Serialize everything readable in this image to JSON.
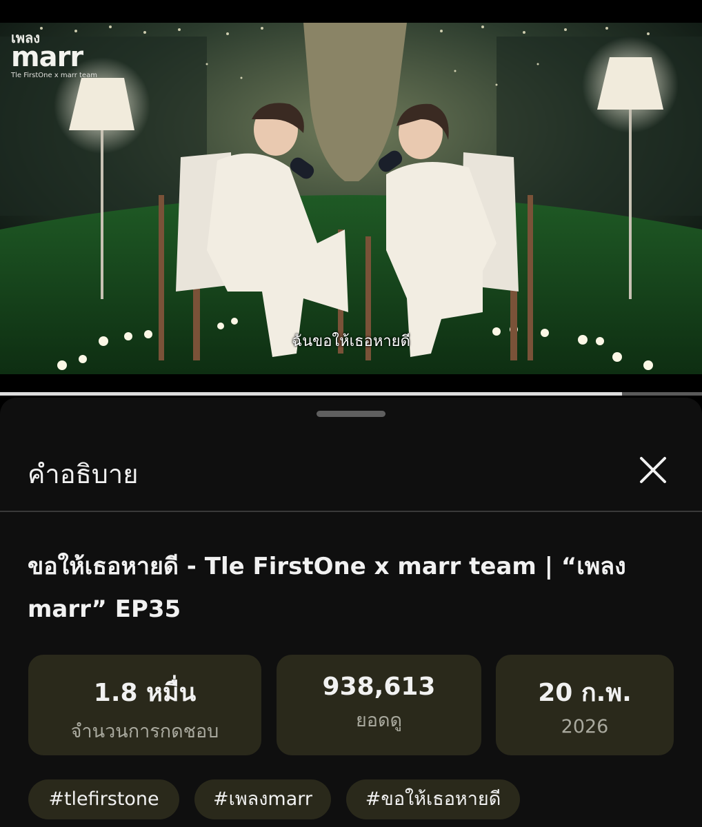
{
  "video": {
    "logo_line1": "เพลง",
    "logo_line2": "marr",
    "logo_line3": "Tle FirstOne x marr team",
    "subtitle": "ฉันขอให้เธอหายดี",
    "progress": 0.886
  },
  "sheet": {
    "title": "คำอธิบาย",
    "close_icon": "close-icon",
    "video_title": "ขอให้เธอหายดี - Tle FirstOne x marr team  |  “เพลง marr” EP35",
    "stats": {
      "likes_value": "1.8 หมื่น",
      "likes_label": "จำนวนการกดชอบ",
      "views_value": "938,613",
      "views_label": "ยอดดู",
      "date_value": "20 ก.พ.",
      "date_label": "2026"
    },
    "hashtags": [
      "#tlefirstone",
      "#เพลงmarr",
      "#ขอให้เธอหายดี"
    ]
  },
  "colors": {
    "sheet_bg": "#0f0f0f",
    "chip_bg": "#2a291b",
    "text_primary": "#f1f1f1",
    "text_secondary": "#a9a99e"
  }
}
